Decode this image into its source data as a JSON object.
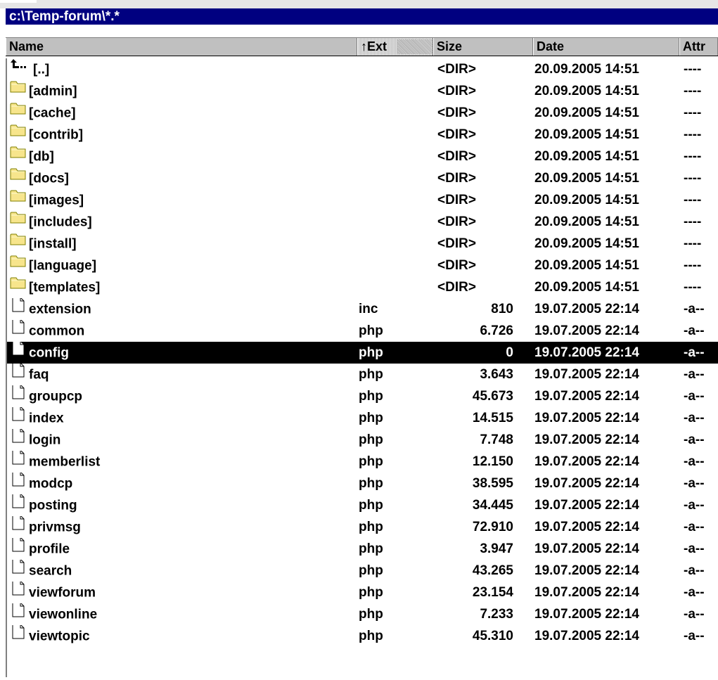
{
  "path": "c:\\Temp-forum\\*.*",
  "columns": {
    "name": "Name",
    "ext": "↑Ext",
    "size": "Size",
    "date": "Date",
    "attr": "Attr"
  },
  "rows": [
    {
      "type": "up",
      "name": "[..]",
      "ext": "",
      "size": "<DIR>",
      "date": "20.09.2005 14:51",
      "attr": "----"
    },
    {
      "type": "dir",
      "name": "[admin]",
      "ext": "",
      "size": "<DIR>",
      "date": "20.09.2005 14:51",
      "attr": "----"
    },
    {
      "type": "dir",
      "name": "[cache]",
      "ext": "",
      "size": "<DIR>",
      "date": "20.09.2005 14:51",
      "attr": "----"
    },
    {
      "type": "dir",
      "name": "[contrib]",
      "ext": "",
      "size": "<DIR>",
      "date": "20.09.2005 14:51",
      "attr": "----"
    },
    {
      "type": "dir",
      "name": "[db]",
      "ext": "",
      "size": "<DIR>",
      "date": "20.09.2005 14:51",
      "attr": "----"
    },
    {
      "type": "dir",
      "name": "[docs]",
      "ext": "",
      "size": "<DIR>",
      "date": "20.09.2005 14:51",
      "attr": "----"
    },
    {
      "type": "dir",
      "name": "[images]",
      "ext": "",
      "size": "<DIR>",
      "date": "20.09.2005 14:51",
      "attr": "----"
    },
    {
      "type": "dir",
      "name": "[includes]",
      "ext": "",
      "size": "<DIR>",
      "date": "20.09.2005 14:51",
      "attr": "----"
    },
    {
      "type": "dir",
      "name": "[install]",
      "ext": "",
      "size": "<DIR>",
      "date": "20.09.2005 14:51",
      "attr": "----"
    },
    {
      "type": "dir",
      "name": "[language]",
      "ext": "",
      "size": "<DIR>",
      "date": "20.09.2005 14:51",
      "attr": "----"
    },
    {
      "type": "dir",
      "name": "[templates]",
      "ext": "",
      "size": "<DIR>",
      "date": "20.09.2005 14:51",
      "attr": "----"
    },
    {
      "type": "file",
      "name": "extension",
      "ext": "inc",
      "size": "810",
      "date": "19.07.2005 22:14",
      "attr": "-a--"
    },
    {
      "type": "file",
      "name": "common",
      "ext": "php",
      "size": "6.726",
      "date": "19.07.2005 22:14",
      "attr": "-a--"
    },
    {
      "type": "file",
      "name": "config",
      "ext": "php",
      "size": "0",
      "date": "19.07.2005 22:14",
      "attr": "-a--",
      "selected": true
    },
    {
      "type": "file",
      "name": "faq",
      "ext": "php",
      "size": "3.643",
      "date": "19.07.2005 22:14",
      "attr": "-a--"
    },
    {
      "type": "file",
      "name": "groupcp",
      "ext": "php",
      "size": "45.673",
      "date": "19.07.2005 22:14",
      "attr": "-a--"
    },
    {
      "type": "file",
      "name": "index",
      "ext": "php",
      "size": "14.515",
      "date": "19.07.2005 22:14",
      "attr": "-a--"
    },
    {
      "type": "file",
      "name": "login",
      "ext": "php",
      "size": "7.748",
      "date": "19.07.2005 22:14",
      "attr": "-a--"
    },
    {
      "type": "file",
      "name": "memberlist",
      "ext": "php",
      "size": "12.150",
      "date": "19.07.2005 22:14",
      "attr": "-a--"
    },
    {
      "type": "file",
      "name": "modcp",
      "ext": "php",
      "size": "38.595",
      "date": "19.07.2005 22:14",
      "attr": "-a--"
    },
    {
      "type": "file",
      "name": "posting",
      "ext": "php",
      "size": "34.445",
      "date": "19.07.2005 22:14",
      "attr": "-a--"
    },
    {
      "type": "file",
      "name": "privmsg",
      "ext": "php",
      "size": "72.910",
      "date": "19.07.2005 22:14",
      "attr": "-a--"
    },
    {
      "type": "file",
      "name": "profile",
      "ext": "php",
      "size": "3.947",
      "date": "19.07.2005 22:14",
      "attr": "-a--"
    },
    {
      "type": "file",
      "name": "search",
      "ext": "php",
      "size": "43.265",
      "date": "19.07.2005 22:14",
      "attr": "-a--"
    },
    {
      "type": "file",
      "name": "viewforum",
      "ext": "php",
      "size": "23.154",
      "date": "19.07.2005 22:14",
      "attr": "-a--"
    },
    {
      "type": "file",
      "name": "viewonline",
      "ext": "php",
      "size": "7.233",
      "date": "19.07.2005 22:14",
      "attr": "-a--"
    },
    {
      "type": "file",
      "name": "viewtopic",
      "ext": "php",
      "size": "45.310",
      "date": "19.07.2005 22:14",
      "attr": "-a--"
    }
  ],
  "icons": {
    "up": "parent-folder-icon",
    "dir": "folder-icon",
    "file": "file-icon"
  },
  "colors": {
    "path_bar_bg": "#000080",
    "folder_fill": "#f7e58c",
    "selection_bg": "#000000"
  }
}
